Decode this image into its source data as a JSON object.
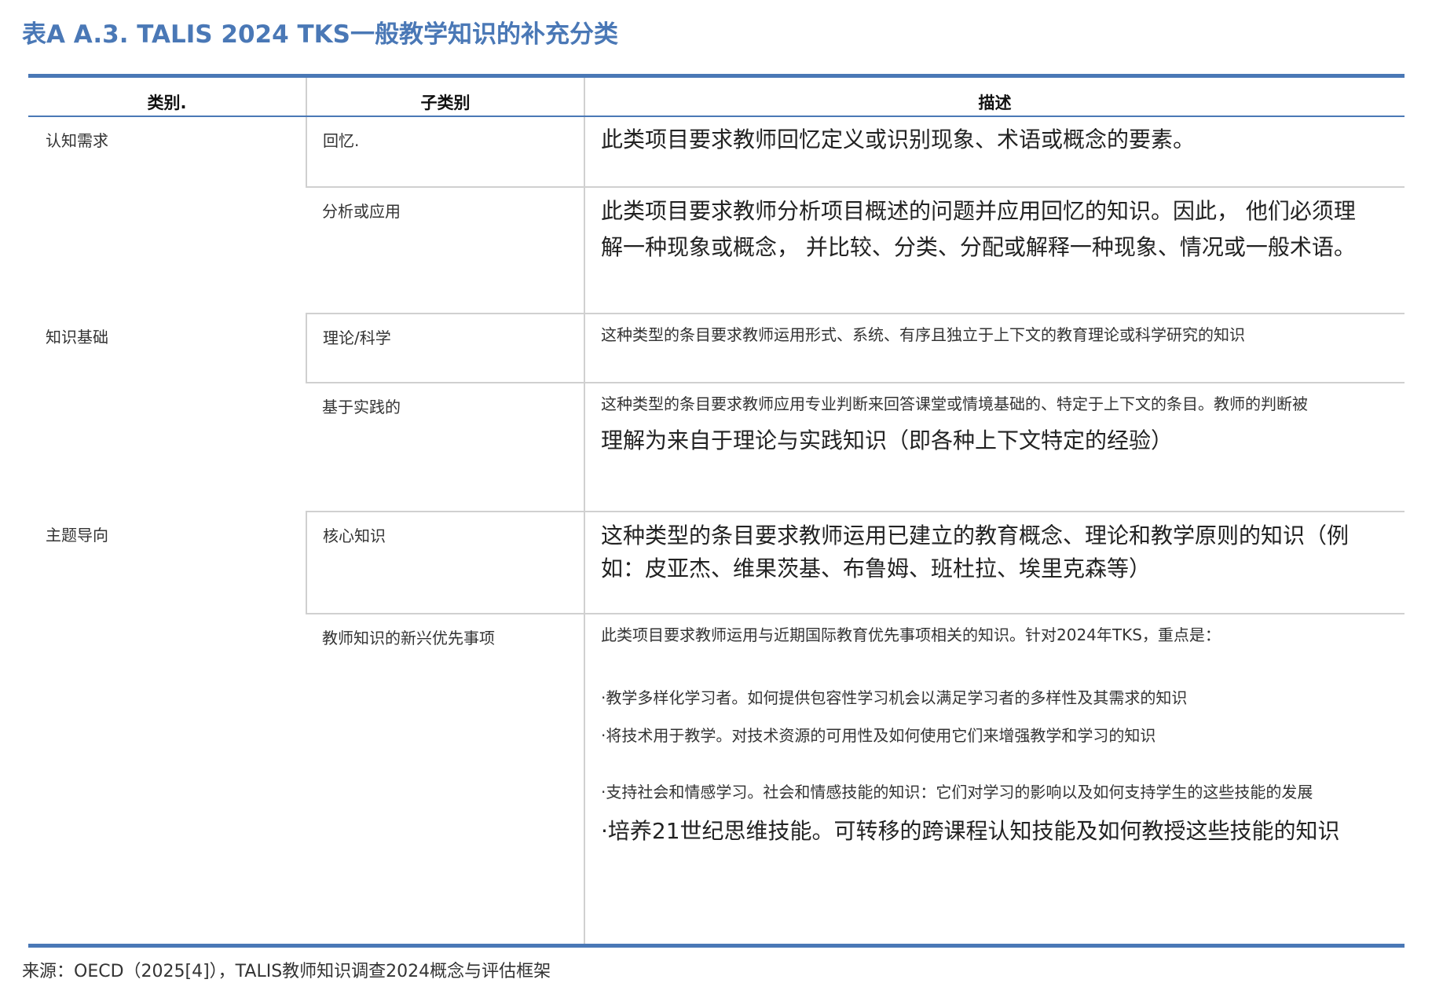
{
  "title": "表A A.3. TALIS 2024 TKS一般教学知识的补充分类",
  "headers": {
    "category": "类别.",
    "subcategory": "子类别",
    "description": "描述"
  },
  "rows": [
    {
      "category": "认知需求",
      "subcategory": "回忆.",
      "description": [
        "此类项目要求教师回忆定义或识别现象、术语或概念的要素。"
      ]
    },
    {
      "category": "",
      "subcategory": "分析或应用",
      "description": [
        "此类项目要求教师分析项目概述的问题并应用回忆的知识。因此， 他们必须理解一种现象或概念， 并比较、分类、分配或解释一种现象、情况或一般术语。"
      ]
    },
    {
      "category": "知识基础",
      "subcategory": "理论/科学",
      "description": [
        "这种类型的条目要求教师运用形式、系统、有序且独立于上下文的教育理论或科学研究的知识"
      ]
    },
    {
      "category": "",
      "subcategory": "基于实践的",
      "description": [
        "这种类型的条目要求教师应用专业判断来回答课堂或情境基础的、特定于上下文的条目。教师的判断被",
        "理解为来自于理论与实践知识（即各种上下文特定的经验）"
      ]
    },
    {
      "category": "主题导向",
      "subcategory": "核心知识",
      "description": [
        "这种类型的条目要求教师运用已建立的教育概念、理论和教学原则的知识（例如：皮亚杰、维果茨基、布鲁姆、班杜拉、埃里克森等）"
      ]
    },
    {
      "category": "",
      "subcategory": "教师知识的新兴优先事项",
      "description": [
        "此类项目要求教师运用与近期国际教育优先事项相关的知识。针对2024年TKS，重点是：",
        "·教学多样化学习者。如何提供包容性学习机会以满足学习者的多样性及其需求的知识",
        "·将技术用于教学。对技术资源的可用性及如何使用它们来增强教学和学习的知识",
        "·支持社会和情感学习。社会和情感技能的知识：它们对学习的影响以及如何支持学生的这些技能的发展",
        "·培养21世纪思维技能。可转移的跨课程认知技能及如何教授这些技能的知识"
      ]
    }
  ],
  "source": "来源：OECD（2025[4]），TALIS教师知识调查2024概念与评估框架"
}
